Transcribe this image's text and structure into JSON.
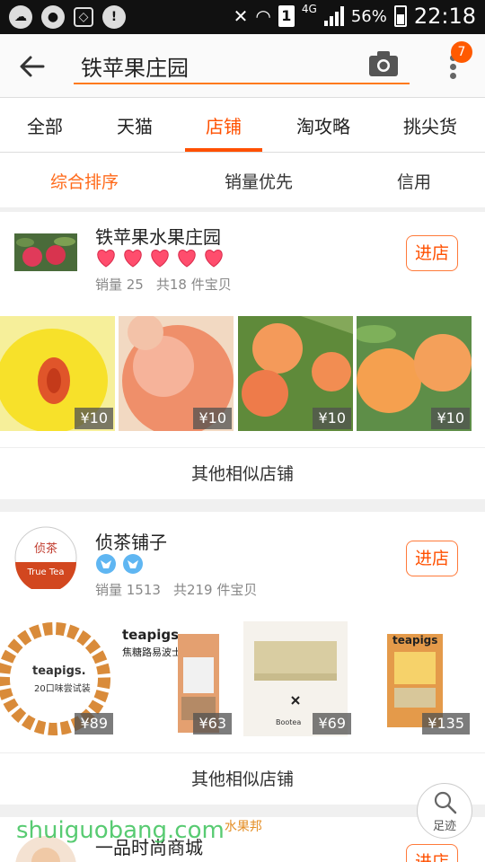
{
  "status_bar": {
    "network": "4G",
    "sim_slot": "1",
    "battery": "56%",
    "time": "22:18"
  },
  "header": {
    "search_value": "铁苹果庄园",
    "cart_badge": "7"
  },
  "tabs": [
    "全部",
    "天猫",
    "店铺",
    "淘攻略",
    "挑尖货"
  ],
  "active_tab": "店铺",
  "sort": [
    "综合排序",
    "销量优先",
    "信用"
  ],
  "shops": [
    {
      "name": "铁苹果水果庄园",
      "rating_icons": "heart",
      "rating_count": 5,
      "sales": "销量 25",
      "items": "共18 件宝贝",
      "enter_label": "进店",
      "products": [
        {
          "price": "¥10"
        },
        {
          "price": "¥10"
        },
        {
          "price": "¥10"
        },
        {
          "price": "¥10"
        }
      ],
      "similar_label": "其他相似店铺"
    },
    {
      "name": "侦茶铺子",
      "logo_text_top": "侦茶",
      "logo_text_bottom": "True Tea",
      "rating_icons": "crown",
      "rating_count": 2,
      "sales": "销量 1513",
      "items": "共219 件宝贝",
      "enter_label": "进店",
      "products": [
        {
          "price": "¥89",
          "brand": "teapigs.",
          "sub": "20口味尝试装"
        },
        {
          "price": "¥63",
          "brand": "teapigs",
          "sub": "焦糖路易波士"
        },
        {
          "price": "¥69",
          "brand": "Bootea"
        },
        {
          "price": "¥135",
          "brand": "teapigs"
        }
      ],
      "similar_label": "其他相似店铺"
    },
    {
      "name": "一品时尚商城",
      "enter_label": "进店"
    }
  ],
  "footprint_label": "足迹",
  "watermark": {
    "text": "shuiguobang.com",
    "sub": "水果邦"
  },
  "colors": {
    "accent": "#ff5000",
    "divider": "#eeeeee"
  }
}
